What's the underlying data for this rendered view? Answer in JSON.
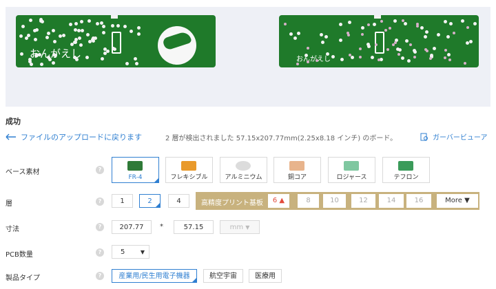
{
  "preview": {
    "board_text_front": "おんがえし",
    "board_text_back": "おんがえし"
  },
  "status": "成功",
  "back_link": "ファイルのアップロードに戻ります",
  "detected_text": "2 層が検出されました 57.15x207.77mm(2.25x8.18 インチ) のボード。",
  "gerber_viewer": "ガーバービューア",
  "labels": {
    "base_material": "ベース素材",
    "layers": "層",
    "dimensions": "寸法",
    "pcb_qty": "PCB数量",
    "product_type": "製品タイプ"
  },
  "help_icon": "?",
  "materials": [
    "FR-4",
    "フレキシブル",
    "アルミニウム",
    "銅コア",
    "ロジャース",
    "テフロン"
  ],
  "layers": [
    "1",
    "2",
    "4"
  ],
  "high_precision": {
    "title": "高精度プリント基板",
    "options": [
      "6",
      "8",
      "10",
      "12",
      "14",
      "16"
    ],
    "more": "More ▼"
  },
  "dimensions": {
    "width": "207.77",
    "separator": "*",
    "height": "57.15",
    "unit": "mm"
  },
  "pcb_qty": "5",
  "product_types": [
    "産業用/民生用電子機器",
    "航空宇宙",
    "医療用"
  ],
  "colors": {
    "accent": "#2f7fd1",
    "board": "#1f7a2a",
    "gold": "#c8b27e"
  }
}
